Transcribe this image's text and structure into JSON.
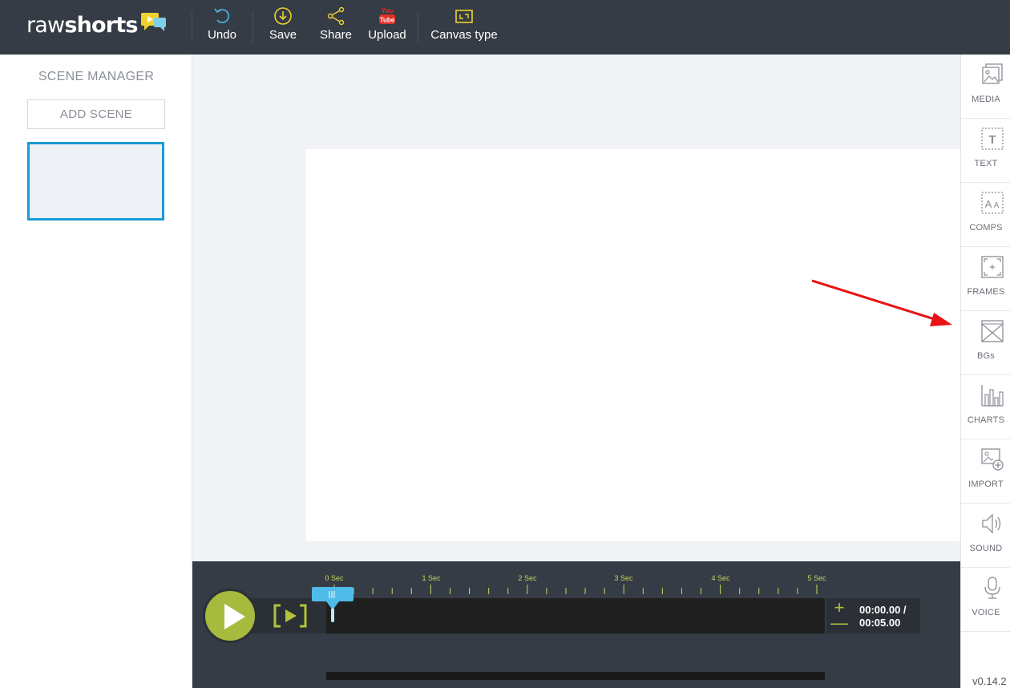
{
  "app": {
    "logo_main": "raw",
    "logo_sub": "shorts"
  },
  "toolbar": {
    "undo": "Undo",
    "save": "Save",
    "share": "Share",
    "upload": "Upload",
    "canvas_type": "Canvas type",
    "upload_icon_text_top": "You",
    "upload_icon_text_bottom": "Tube"
  },
  "scene_manager": {
    "title": "SCENE MANAGER",
    "add_scene": "ADD SCENE"
  },
  "timeline": {
    "ticks": [
      "0 Sec",
      "1 Sec",
      "2 Sec",
      "3 Sec",
      "4 Sec",
      "5 Sec"
    ],
    "current_time": "00:00.00 /",
    "total_time": "00:05.00",
    "zoom_in": "+",
    "zoom_out": "—"
  },
  "tools": [
    {
      "label": "MEDIA",
      "icon": "media-icon"
    },
    {
      "label": "TEXT",
      "icon": "text-icon"
    },
    {
      "label": "COMPS",
      "icon": "comps-icon"
    },
    {
      "label": "FRAMES",
      "icon": "frames-icon"
    },
    {
      "label": "BGs",
      "icon": "backgrounds-icon"
    },
    {
      "label": "CHARTS",
      "icon": "charts-icon"
    },
    {
      "label": "IMPORT",
      "icon": "import-icon"
    },
    {
      "label": "SOUND",
      "icon": "sound-icon"
    },
    {
      "label": "VOICE",
      "icon": "voice-icon"
    }
  ],
  "version": "v0.14.2",
  "colors": {
    "topbar": "#363c45",
    "accent_green": "#a6ba3d",
    "accent_blue": "#1a9ad6",
    "icon_yellow": "#f0d22e",
    "annotation_red": "#e81212"
  }
}
